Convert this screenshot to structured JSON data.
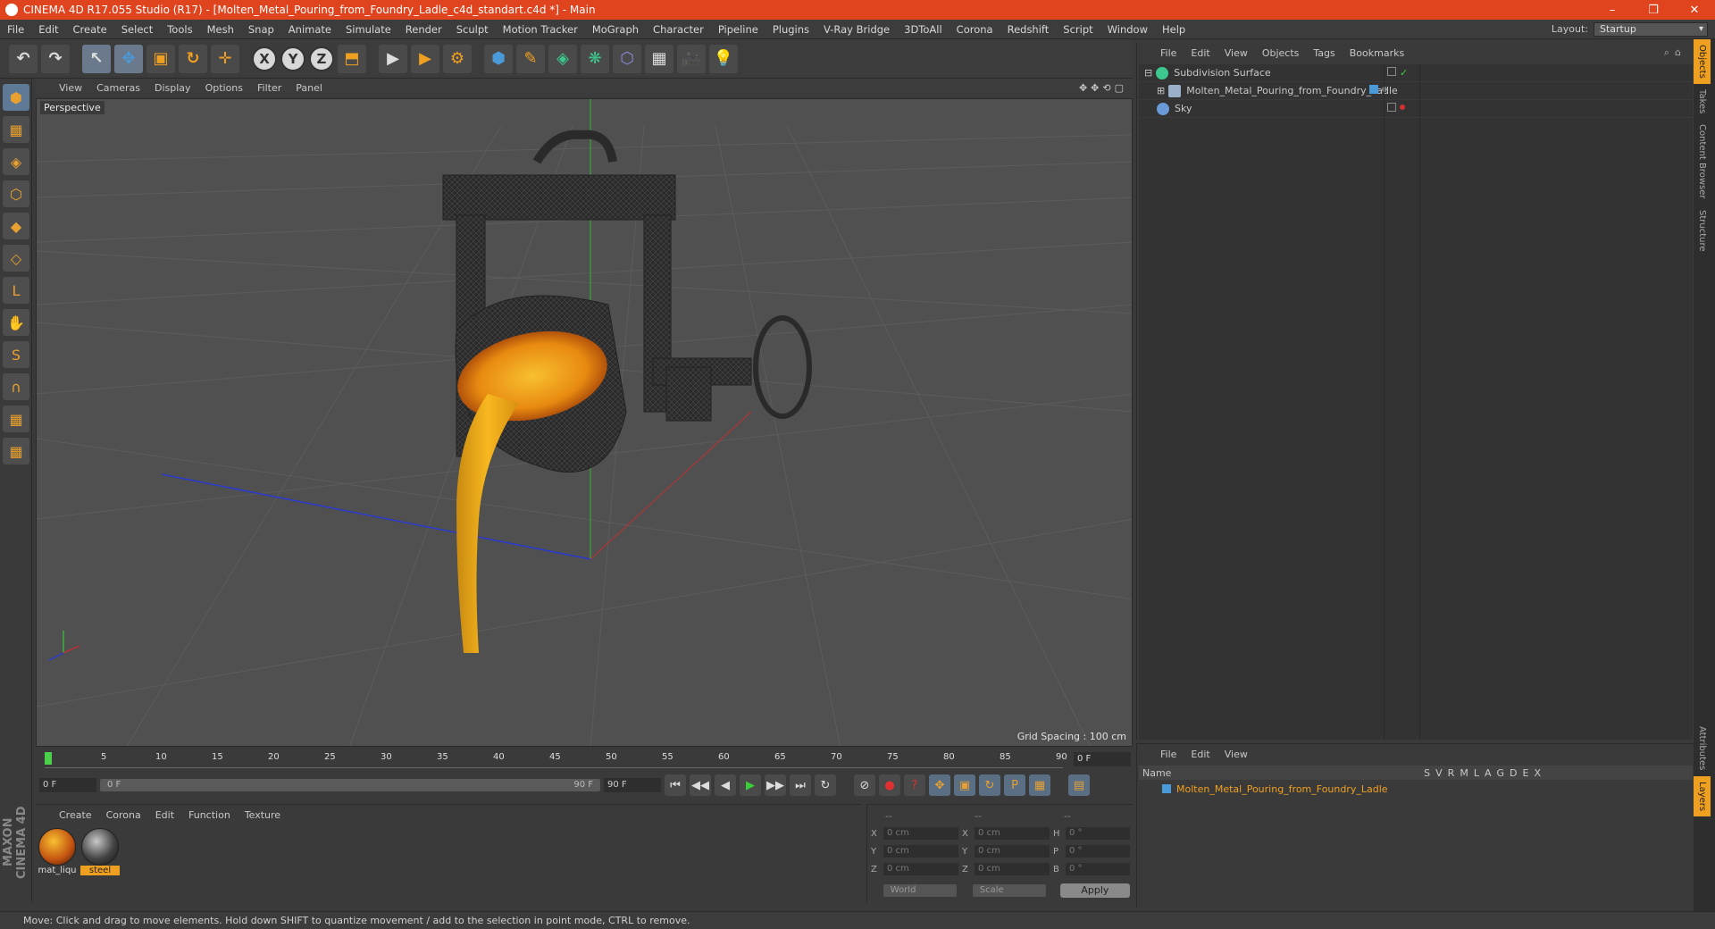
{
  "window": {
    "title": "CINEMA 4D R17.055 Studio (R17) - [Molten_Metal_Pouring_from_Foundry_Ladle_c4d_standart.c4d *] - Main",
    "minimize": "–",
    "maximize": "❐",
    "close": "✕"
  },
  "menu": [
    "File",
    "Edit",
    "Create",
    "Select",
    "Tools",
    "Mesh",
    "Snap",
    "Animate",
    "Simulate",
    "Render",
    "Sculpt",
    "Motion Tracker",
    "MoGraph",
    "Character",
    "Pipeline",
    "Plugins",
    "V-Ray Bridge",
    "3DToAll",
    "Corona",
    "Redshift",
    "Script",
    "Window",
    "Help"
  ],
  "layout": {
    "label": "Layout:",
    "value": "Startup"
  },
  "toolbar": {
    "undo": "↶",
    "redo": "↷",
    "select": "↖",
    "move": "✥",
    "scale": "▣",
    "rotate": "↻",
    "create": "✛",
    "x": "X",
    "y": "Y",
    "z": "Z",
    "coord": "⬒",
    "render_view": "▶",
    "render_picture": "▶",
    "render_settings": "⚙",
    "cube": "⬢",
    "pen": "✎",
    "subdiv": "◈",
    "array": "❋",
    "deform": "⬡",
    "floor": "▦",
    "camera": "🎥",
    "light": "💡"
  },
  "left_tools": [
    "⬢",
    "▦",
    "◈",
    "⬡",
    "◆",
    "◇",
    "L",
    "✋",
    "S",
    "∩",
    "▦",
    "▦"
  ],
  "viewport": {
    "menu": [
      "View",
      "Cameras",
      "Display",
      "Options",
      "Filter",
      "Panel"
    ],
    "icons": "✥✥⟲▢",
    "label": "Perspective",
    "grid_spacing": "Grid Spacing : 100 cm"
  },
  "timeline": {
    "ticks": [
      "0",
      "5",
      "10",
      "15",
      "20",
      "25",
      "30",
      "35",
      "40",
      "45",
      "50",
      "55",
      "60",
      "65",
      "70",
      "75",
      "80",
      "85",
      "90"
    ],
    "current_frame": "0 F"
  },
  "transport": {
    "start": "0 F",
    "slider_left": "0 F",
    "slider_right": "90 F",
    "end": "90 F",
    "buttons": [
      "⏮",
      "◀◀",
      "◀",
      "▶",
      "▶▶",
      "⏭",
      "↻"
    ],
    "key_buttons": [
      "⊘",
      "●",
      "?",
      "✥",
      "▣",
      "↻",
      "P",
      "▦",
      "▤"
    ]
  },
  "materials": {
    "menu": [
      "Create",
      "Corona",
      "Edit",
      "Function",
      "Texture"
    ],
    "items": [
      {
        "name": "mat_liqu",
        "active": false
      },
      {
        "name": "steel",
        "active": true
      }
    ]
  },
  "coordinates": {
    "header": [
      "--",
      "--",
      "--"
    ],
    "rows": [
      {
        "a": "X",
        "av": "0 cm",
        "b": "X",
        "bv": "0 cm",
        "c": "H",
        "cv": "0 °"
      },
      {
        "a": "Y",
        "av": "0 cm",
        "b": "Y",
        "bv": "0 cm",
        "c": "P",
        "cv": "0 °"
      },
      {
        "a": "Z",
        "av": "0 cm",
        "b": "Z",
        "bv": "0 cm",
        "c": "B",
        "cv": "0 °"
      }
    ],
    "world": "World",
    "scale": "Scale",
    "apply": "Apply"
  },
  "object_manager": {
    "menu": [
      "File",
      "Edit",
      "View",
      "Objects",
      "Tags",
      "Bookmarks"
    ],
    "objects": [
      {
        "name": "Subdivision Surface",
        "color": "#3cc88c",
        "indent": 0
      },
      {
        "name": "Molten_Metal_Pouring_from_Foundry_Ladle",
        "color": "#9ab0c8",
        "indent": 1
      },
      {
        "name": "Sky",
        "color": "#6a9ad8",
        "indent": 0
      }
    ]
  },
  "layer_manager": {
    "menu": [
      "File",
      "Edit",
      "View"
    ],
    "header_name": "Name",
    "columns": [
      "S",
      "V",
      "R",
      "M",
      "L",
      "A",
      "G",
      "D",
      "E",
      "X"
    ],
    "layer": "Molten_Metal_Pouring_from_Foundry_Ladle"
  },
  "side_tabs": [
    "Objects",
    "Takes",
    "Content Browser",
    "Structure",
    "Attributes",
    "Layers"
  ],
  "status": "Move: Click and drag to move elements. Hold down SHIFT to quantize movement / add to the selection in point mode, CTRL to remove.",
  "brand": "MAXON CINEMA 4D",
  "colors": {
    "accent": "#e0441e",
    "highlight": "#f0a020",
    "molten": "#f4b01a"
  }
}
